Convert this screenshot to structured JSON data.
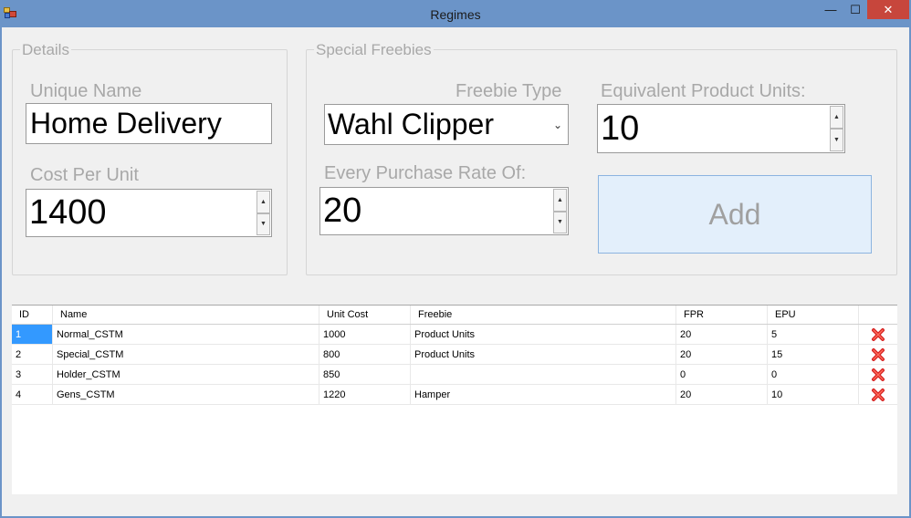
{
  "window": {
    "title": "Regimes"
  },
  "titlebar": {
    "minimize_glyph": "—",
    "maximize_glyph": "☐",
    "close_glyph": "✕"
  },
  "details": {
    "title": "Details",
    "unique_name_label": "Unique Name",
    "unique_name_value": "Home Delivery",
    "cost_per_unit_label": "Cost Per Unit",
    "cost_per_unit_value": "1400"
  },
  "freebies": {
    "title": "Special Freebies",
    "freebie_type_label": "Freebie Type",
    "freebie_type_value": "Wahl Clipper",
    "epu_label": "Equivalent Product Units:",
    "epu_value": "10",
    "rate_label": "Every Purchase Rate Of:",
    "rate_value": "20",
    "add_label": "Add"
  },
  "grid": {
    "columns": [
      "ID",
      "Name",
      "Unit Cost",
      "Freebie",
      "FPR",
      "EPU",
      ""
    ],
    "rows": [
      {
        "id": "1",
        "name": "Normal_CSTM",
        "unit_cost": "1000",
        "freebie": "Product Units",
        "fpr": "20",
        "epu": "5"
      },
      {
        "id": "2",
        "name": "Special_CSTM",
        "unit_cost": "800",
        "freebie": "Product Units",
        "fpr": "20",
        "epu": "15"
      },
      {
        "id": "3",
        "name": "Holder_CSTM",
        "unit_cost": "850",
        "freebie": "",
        "fpr": "0",
        "epu": "0"
      },
      {
        "id": "4",
        "name": "Gens_CSTM",
        "unit_cost": "1220",
        "freebie": "Hamper",
        "fpr": "20",
        "epu": "10"
      }
    ],
    "delete_icon": "red-x-delete-icon",
    "selection_color": "#3399ff"
  }
}
